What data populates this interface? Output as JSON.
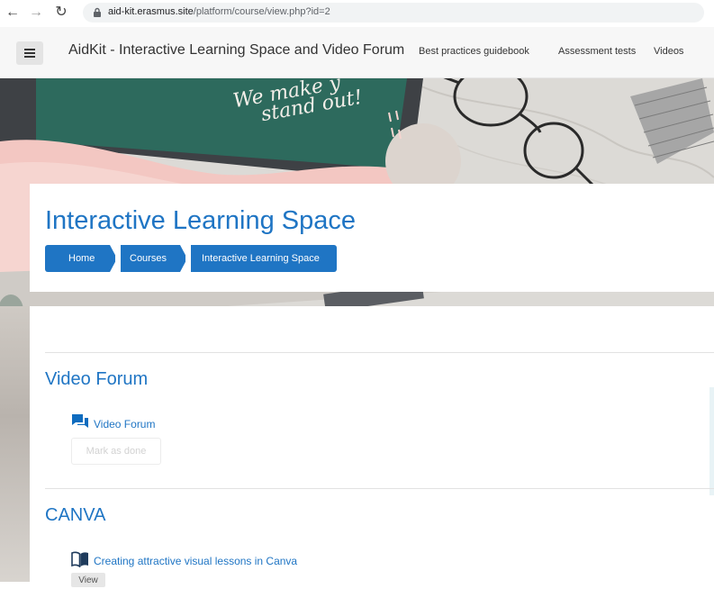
{
  "browser": {
    "url_host": "aid-kit.erasmus.site",
    "url_path": "/platform/course/view.php?id=2"
  },
  "navbar": {
    "site_title": "AidKit - Interactive Learning Space and Video Forum",
    "links": [
      "Best practices guidebook",
      "Assessment tests",
      "Videos"
    ]
  },
  "hero": {
    "chalkboard_text": [
      "We make y",
      "stand out!"
    ],
    "course_title": "Interactive Learning Space",
    "breadcrumb": [
      "Home",
      "Courses",
      "Interactive Learning Space"
    ]
  },
  "sections": [
    {
      "title": "Video Forum",
      "activity": {
        "icon": "forum-icon",
        "label": "Video Forum"
      },
      "completion_button": "Mark as done"
    },
    {
      "title": "CANVA",
      "activity": {
        "icon": "book-icon",
        "label": "Creating attractive visual lessons in Canva"
      },
      "action_button": "View"
    }
  ],
  "colors": {
    "primary": "#1f75c4",
    "navbar_bg": "#f7f7f7",
    "chalkboard": "#2d6a5d"
  }
}
